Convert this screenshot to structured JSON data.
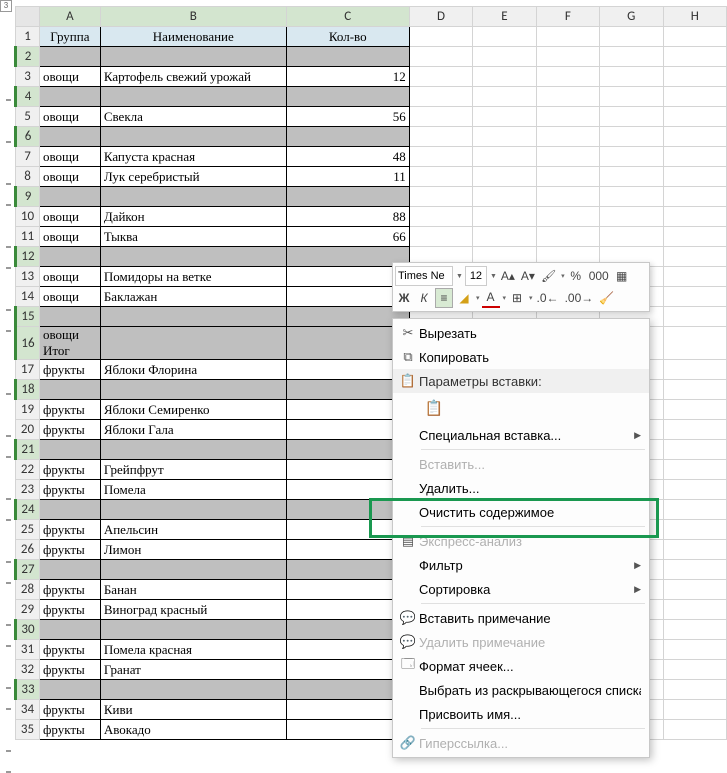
{
  "outline_level": "3",
  "columns": [
    "A",
    "B",
    "C",
    "D",
    "E",
    "F",
    "G",
    "H"
  ],
  "headers": {
    "a": "Группа",
    "b": "Наименование",
    "c": "Кол-во"
  },
  "rows": [
    {
      "n": 1,
      "type": "header"
    },
    {
      "n": 2,
      "type": "sel"
    },
    {
      "n": 3,
      "a": "овощи",
      "b": "Картофель свежий урожай",
      "c": "12"
    },
    {
      "n": 4,
      "type": "sel"
    },
    {
      "n": 5,
      "a": "овощи",
      "b": "Свекла",
      "c": "56"
    },
    {
      "n": 6,
      "type": "sel"
    },
    {
      "n": 7,
      "a": "овощи",
      "b": "Капуста красная",
      "c": "48"
    },
    {
      "n": 8,
      "a": "овощи",
      "b": "Лук серебристый",
      "c": "11"
    },
    {
      "n": 9,
      "type": "sel"
    },
    {
      "n": 10,
      "a": "овощи",
      "b": "Дайкон",
      "c": "88"
    },
    {
      "n": 11,
      "a": "овощи",
      "b": "Тыква",
      "c": "66"
    },
    {
      "n": 12,
      "type": "sel"
    },
    {
      "n": 13,
      "a": "овощи",
      "b": "Помидоры на ветке",
      "c": ""
    },
    {
      "n": 14,
      "a": "овощи",
      "b": "Баклажан",
      "c": ""
    },
    {
      "n": 15,
      "type": "sel"
    },
    {
      "n": 16,
      "a": "овощи Итог",
      "b": "",
      "c": "",
      "bold": true,
      "type": "sel"
    },
    {
      "n": 17,
      "a": "фрукты",
      "b": "Яблоки Флорина",
      "c": ""
    },
    {
      "n": 18,
      "type": "sel"
    },
    {
      "n": 19,
      "a": "фрукты",
      "b": "Яблоки Семиренко",
      "c": ""
    },
    {
      "n": 20,
      "a": "фрукты",
      "b": "Яблоки Гала",
      "c": ""
    },
    {
      "n": 21,
      "type": "sel"
    },
    {
      "n": 22,
      "a": "фрукты",
      "b": "Грейпфрут",
      "c": ""
    },
    {
      "n": 23,
      "a": "фрукты",
      "b": "Помела",
      "c": ""
    },
    {
      "n": 24,
      "type": "sel"
    },
    {
      "n": 25,
      "a": "фрукты",
      "b": "Апельсин",
      "c": ""
    },
    {
      "n": 26,
      "a": "фрукты",
      "b": "Лимон",
      "c": ""
    },
    {
      "n": 27,
      "type": "sel"
    },
    {
      "n": 28,
      "a": "фрукты",
      "b": "Банан",
      "c": ""
    },
    {
      "n": 29,
      "a": "фрукты",
      "b": "Виноград  красный",
      "c": ""
    },
    {
      "n": 30,
      "type": "sel"
    },
    {
      "n": 31,
      "a": "фрукты",
      "b": "Помела красная",
      "c": ""
    },
    {
      "n": 32,
      "a": "фрукты",
      "b": "Гранат",
      "c": ""
    },
    {
      "n": 33,
      "type": "sel"
    },
    {
      "n": 34,
      "a": "фрукты",
      "b": "Киви",
      "c": ""
    },
    {
      "n": 35,
      "a": "фрукты",
      "b": "Авокадо",
      "c": ""
    }
  ],
  "mini_toolbar": {
    "font": "Times Ne",
    "size": "12",
    "grow": "A▴",
    "shrink": "A▾",
    "bold": "Ж",
    "italic": "К",
    "percent": "%",
    "thousands": "000"
  },
  "context_menu": {
    "cut": "Вырезать",
    "copy": "Копировать",
    "paste_options": "Параметры вставки:",
    "paste_special": "Специальная вставка...",
    "insert": "Вставить...",
    "delete": "Удалить...",
    "clear": "Очистить содержимое",
    "quick_analysis": "Экспресс-анализ",
    "filter": "Фильтр",
    "sort": "Сортировка",
    "insert_comment": "Вставить примечание",
    "delete_comment": "Удалить примечание",
    "format_cells": "Формат ячеек...",
    "pick_from_list": "Выбрать из раскрывающегося списка...",
    "define_name": "Присвоить имя...",
    "hyperlink": "Гиперссылка..."
  }
}
